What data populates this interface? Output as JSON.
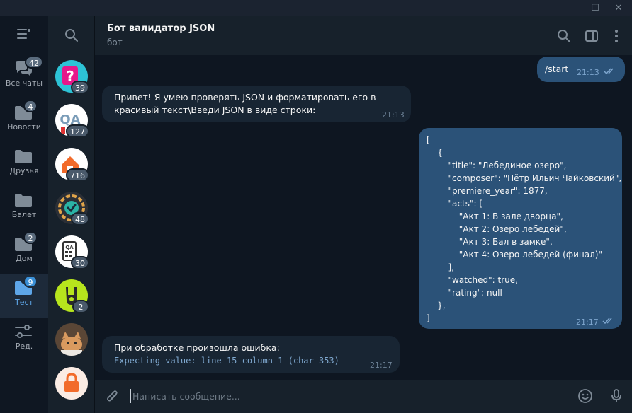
{
  "window": {
    "controls": {
      "minimize": "—",
      "maximize": "☐",
      "close": "✕"
    }
  },
  "folders": [
    {
      "label": "Все чаты",
      "badge": "42",
      "icon": "chats-icon",
      "active": false
    },
    {
      "label": "Новости",
      "badge": "4",
      "icon": "folder-icon",
      "active": false
    },
    {
      "label": "Друзья",
      "badge": "",
      "icon": "folder-icon",
      "active": false
    },
    {
      "label": "Балет",
      "badge": "",
      "icon": "folder-icon",
      "active": false
    },
    {
      "label": "Дом",
      "badge": "2",
      "icon": "folder-icon",
      "active": false
    },
    {
      "label": "Тест",
      "badge": "9",
      "icon": "folder-icon",
      "active": true
    },
    {
      "label": "Ред.",
      "badge": "",
      "icon": "edit-filters-icon",
      "active": false
    }
  ],
  "chats": [
    {
      "badge": "39",
      "avatar": "question-mark-avatar",
      "color": "#2dc3d6"
    },
    {
      "badge": "127",
      "avatar": "qa-logo-avatar",
      "color": "#ffffff"
    },
    {
      "badge": "716",
      "avatar": "orange-house-avatar",
      "color": "#ffffff"
    },
    {
      "badge": "48",
      "avatar": "gauge-check-avatar",
      "color": "#2b2f36"
    },
    {
      "badge": "30",
      "avatar": "qa-calculator-avatar",
      "color": "#ffffff"
    },
    {
      "badge": "2",
      "avatar": "rock-hand-avatar",
      "color": "#b7e51d"
    },
    {
      "badge": "",
      "avatar": "cat-photo-avatar",
      "color": "#8a6a4e"
    },
    {
      "badge": "",
      "avatar": "lock-avatar",
      "color": "#fbece4"
    }
  ],
  "header": {
    "title": "Бот валидатор JSON",
    "subtitle": "бот"
  },
  "messages": {
    "m1": {
      "text": "/start",
      "time": "21:13",
      "direction": "out",
      "status": "read"
    },
    "m2": {
      "line1": "Привет! Я умею проверять JSON и форматировать его в",
      "line2": "красивый текст\\Введи JSON в виде строки:",
      "time": "21:13",
      "direction": "in"
    },
    "m3": {
      "lines": [
        "[",
        "    {",
        "        \"title\": \"Лебединое озеро\",",
        "        \"composer\": \"Пётр Ильич Чайковский\",",
        "        \"premiere_year\": 1877,",
        "        \"acts\": [",
        "            \"Акт 1: В зале дворца\",",
        "            \"Акт 2: Озеро лебедей\",",
        "            \"Акт 3: Бал в замке\",",
        "            \"Акт 4: Озеро лебедей (финал)\"",
        "        ],",
        "        \"watched\": true,",
        "        \"rating\": null",
        "    },",
        "]"
      ],
      "time": "21:17",
      "direction": "out",
      "status": "read"
    },
    "m4": {
      "line1": "При обработке произошла ошибка:",
      "code": "Expecting value: line 15 column 1 (char 353)",
      "time": "21:17",
      "direction": "in"
    }
  },
  "compose": {
    "placeholder": "Написать сообщение..."
  },
  "colors": {
    "background": "#0e1621",
    "panel": "#17212b",
    "outgoing": "#2b5278",
    "incoming": "#182533",
    "accent": "#5ea6e8"
  }
}
